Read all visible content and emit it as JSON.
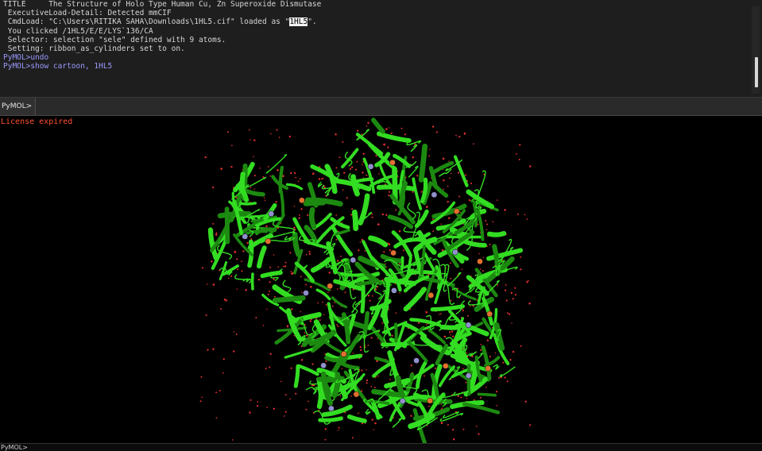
{
  "console": {
    "truncated_line": "Header of prior output (cut off at top edge)",
    "lines": [
      {
        "text": "TITLE     The Structure of Holo Type Human Cu, Zn Superoxide Dismutase",
        "kind": "out"
      },
      {
        "text": " ExecutiveLoad-Detail: Detected mmCIF",
        "kind": "out"
      },
      {
        "pre": " CmdLoad: \"C:\\Users\\RITIKA SAHA\\Downloads\\1HL5.cif\" loaded as \"",
        "highlight": "1HL5",
        "post": "\".",
        "kind": "out"
      },
      {
        "text": " You clicked /1HL5/E/E/LYS`136/CA",
        "kind": "out"
      },
      {
        "text": " Selector: selection \"sele\" defined with 9 atoms.",
        "kind": "out"
      },
      {
        "text": " Setting: ribbon_as_cylinders set to on.",
        "kind": "out"
      },
      {
        "text": "PyMOL>undo",
        "kind": "cmd"
      },
      {
        "text": "PyMOL>show cartoon, 1HL5",
        "kind": "cmd"
      }
    ]
  },
  "command_bar": {
    "prompt": "PyMOL>",
    "value": ""
  },
  "viewport": {
    "notice": "License expired",
    "object": "1HL5",
    "representation": "cartoon",
    "colors": {
      "cartoon": "#33dd22",
      "cartoon_shade": "#1c8a10",
      "water": "#e03030",
      "copper": "#e07030",
      "zinc": "#9090cc"
    }
  },
  "bottom_bar": {
    "prompt": "PyMOL>"
  }
}
